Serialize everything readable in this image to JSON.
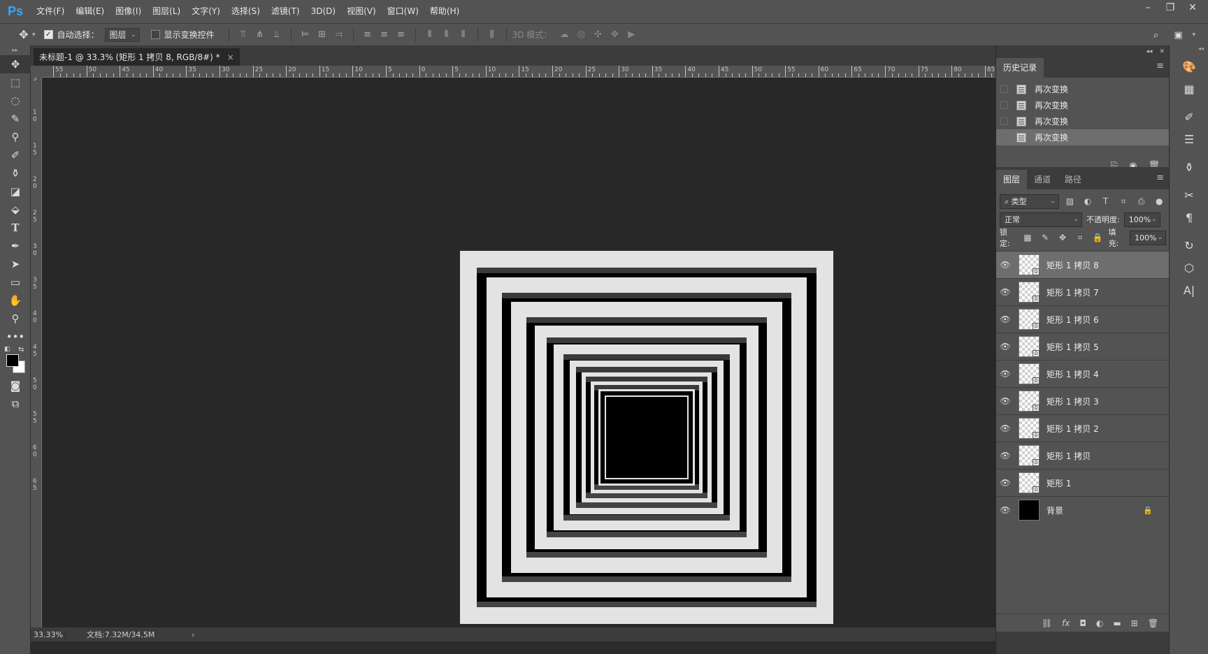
{
  "app": {
    "logo": "Ps"
  },
  "menu": [
    "文件(F)",
    "编辑(E)",
    "图像(I)",
    "图层(L)",
    "文字(Y)",
    "选择(S)",
    "滤镜(T)",
    "3D(D)",
    "视图(V)",
    "窗口(W)",
    "帮助(H)"
  ],
  "window_controls": {
    "minimize": "–",
    "restore": "❐",
    "close": "✕"
  },
  "options": {
    "auto_select_label": "自动选择：",
    "auto_select_checked": true,
    "auto_select_target": "图层",
    "show_transform_label": "显示变换控件",
    "show_transform_checked": false,
    "mode_3d_label": "3D 模式："
  },
  "document": {
    "tab_title": "未标题-1 @ 33.3% (矩形 1 拷贝 8, RGB/8#) *",
    "close": "×"
  },
  "rulers": {
    "horizontal": [
      "55",
      "50",
      "45",
      "40",
      "35",
      "30",
      "25",
      "20",
      "15",
      "10",
      "5",
      "0",
      "5",
      "10",
      "15",
      "20",
      "25",
      "30",
      "35",
      "40",
      "45",
      "50",
      "55",
      "60",
      "65",
      "70",
      "75",
      "80",
      "85"
    ],
    "vertical": [
      "5",
      "1 0",
      "1 5",
      "2 0",
      "2 5",
      "3 0",
      "3 5",
      "4 0",
      "4 5",
      "5 0",
      "5 5",
      "6 0",
      "6 5"
    ]
  },
  "status": {
    "zoom": "33.33%",
    "doc_size": "文档:7.32M/34.5M",
    "arrow": "›"
  },
  "history": {
    "tab": "历史记录",
    "items": [
      {
        "label": "再次变换",
        "selected": false
      },
      {
        "label": "再次变换",
        "selected": false
      },
      {
        "label": "再次变换",
        "selected": false
      },
      {
        "label": "再次变换",
        "selected": true
      }
    ]
  },
  "layers_panel": {
    "tabs": [
      "图层",
      "通道",
      "路径"
    ],
    "filter_kind": "类型",
    "blend_mode": "正常",
    "opacity_label": "不透明度:",
    "opacity_value": "100%",
    "lock_label": "锁定:",
    "fill_label": "填充:",
    "fill_value": "100%",
    "layers": [
      {
        "name": "矩形 1 拷贝 8",
        "selected": true,
        "kind": "smart"
      },
      {
        "name": "矩形 1 拷贝 7",
        "selected": false,
        "kind": "smart"
      },
      {
        "name": "矩形 1 拷贝 6",
        "selected": false,
        "kind": "smart"
      },
      {
        "name": "矩形 1 拷贝 5",
        "selected": false,
        "kind": "smart"
      },
      {
        "name": "矩形 1 拷贝 4",
        "selected": false,
        "kind": "smart"
      },
      {
        "name": "矩形 1 拷贝 3",
        "selected": false,
        "kind": "smart"
      },
      {
        "name": "矩形 1 拷贝 2",
        "selected": false,
        "kind": "smart"
      },
      {
        "name": "矩形 1 拷贝",
        "selected": false,
        "kind": "smart"
      },
      {
        "name": "矩形 1",
        "selected": false,
        "kind": "smart"
      },
      {
        "name": "背景",
        "selected": false,
        "kind": "background",
        "locked": true
      }
    ]
  },
  "colors": {
    "foreground": "#000000",
    "background": "#ffffff",
    "artboard": "#e3e3e3",
    "accent": "#31a8ff"
  }
}
